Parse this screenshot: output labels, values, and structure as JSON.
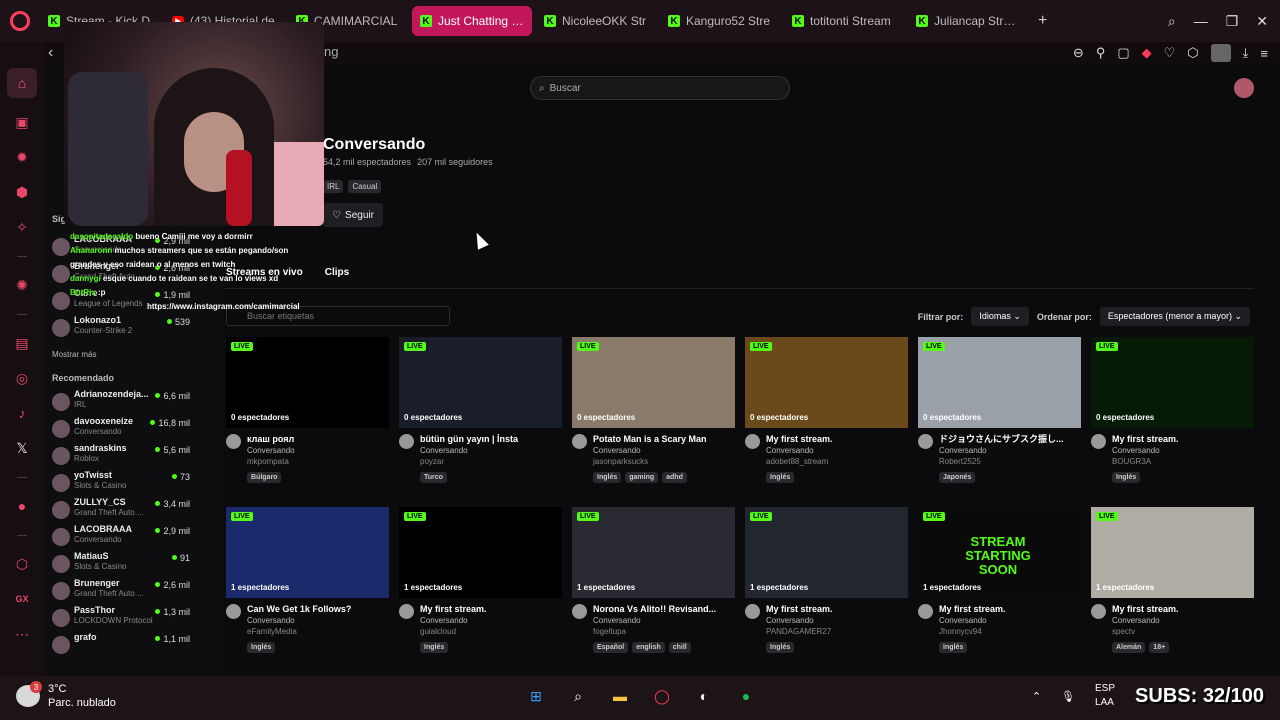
{
  "tabs": [
    {
      "label": "Stream - Kick D",
      "icon": "kick-icon",
      "active": false
    },
    {
      "label": "(43) Historial de",
      "icon": "youtube-icon",
      "active": false
    },
    {
      "label": "CAMIMARCIAL",
      "icon": "kick-icon",
      "active": false
    },
    {
      "label": "Just Chatting Streaming",
      "icon": "kick-icon",
      "active": true
    },
    {
      "label": "NicoleeOKK Str",
      "icon": "kick-icon",
      "active": false
    },
    {
      "label": "Kanguro52 Stre",
      "icon": "kick-icon",
      "active": false
    },
    {
      "label": "totitonti Stream",
      "icon": "kick-icon",
      "active": false
    },
    {
      "label": "Juliancap Stream",
      "icon": "kick-icon",
      "active": false
    }
  ],
  "url_fragment": "ng",
  "search": {
    "placeholder": "Buscar"
  },
  "category": {
    "title": "Conversando",
    "viewers": "54,2 mil espectadores",
    "followers": "207 mil seguidores",
    "tags": [
      "IRL",
      "Casual"
    ],
    "follow_label": "Seguir"
  },
  "subtabs": [
    "Streams en vivo",
    "Clips"
  ],
  "tag_search_placeholder": "Buscar etiquetas",
  "filters": {
    "filter_label": "Filtrar por:",
    "filter_value": "Idiomas",
    "order_label": "Ordenar por:",
    "order_value": "Espectadores (menor a mayor)"
  },
  "sidebar": {
    "following_header": "Sig",
    "following": [
      {
        "name": "LACOBRAAA",
        "category": "Conversando",
        "viewers": "2,9 mil"
      },
      {
        "name": "Brunenger",
        "category": "Grand Theft Auto ...",
        "viewers": "2,6 mil"
      },
      {
        "name": "Carre",
        "category": "League of Legends",
        "viewers": "1,9 mil"
      },
      {
        "name": "Lokonazo1",
        "category": "Counter-Strike 2",
        "viewers": "539"
      }
    ],
    "show_more": "Mostrar más",
    "recommended_header": "Recomendado",
    "recommended": [
      {
        "name": "Adrianozendeja...",
        "category": "IRL",
        "viewers": "6,6 mil"
      },
      {
        "name": "davooxeneize",
        "category": "Conversando",
        "viewers": "16,8 mil"
      },
      {
        "name": "sandraskins",
        "category": "Roblox",
        "viewers": "5,6 mil"
      },
      {
        "name": "yoTwisst",
        "category": "Slots & Casino",
        "viewers": "73"
      },
      {
        "name": "ZULLYY_CS",
        "category": "Grand Theft Auto ...",
        "viewers": "3,4 mil"
      },
      {
        "name": "LACOBRAAA",
        "category": "Conversando",
        "viewers": "2,9 mil"
      },
      {
        "name": "MatiauS",
        "category": "Slots & Casino",
        "viewers": "91"
      },
      {
        "name": "Brunenger",
        "category": "Grand Theft Auto ...",
        "viewers": "2,6 mil"
      },
      {
        "name": "PassThor",
        "category": "LOCKDOWN Protocol",
        "viewers": "1,3 mil"
      },
      {
        "name": "grafo",
        "category": "",
        "viewers": "1,1 mil"
      }
    ]
  },
  "streams_row1": [
    {
      "live": "LIVE",
      "viewers": "0 espectadores",
      "title": "клаш роял",
      "category": "Conversando",
      "owner": "mkpompata",
      "tags": [
        "Búlgaro"
      ],
      "thumb": "#000000"
    },
    {
      "live": "LIVE",
      "viewers": "0 espectadores",
      "title": "bütün gün yayın | İnsta",
      "category": "Conversando",
      "owner": "poyzar",
      "tags": [
        "Turco"
      ],
      "thumb": "#1a1d2a"
    },
    {
      "live": "LIVE",
      "viewers": "0 espectadores",
      "title": "Potato Man is a Scary Man",
      "category": "Conversando",
      "owner": "jasonparksucks",
      "tags": [
        "Inglés",
        "gaming",
        "adhd"
      ],
      "thumb": "#8a7a6a"
    },
    {
      "live": "LIVE",
      "viewers": "0 espectadores",
      "title": "My first stream.",
      "category": "Conversando",
      "owner": "adobet88_stream",
      "tags": [
        "Inglés"
      ],
      "thumb": "#6a4a1a"
    },
    {
      "live": "LIVE",
      "viewers": "0 espectadores",
      "title": "ドジョウさんにサブスク振し...",
      "category": "Conversando",
      "owner": "Robert2525",
      "tags": [
        "Japonés"
      ],
      "thumb": "#9aa0a8"
    },
    {
      "live": "LIVE",
      "viewers": "0 espectadores",
      "title": "My first stream.",
      "category": "Conversando",
      "owner": "BOUGR3A",
      "tags": [
        "Inglés"
      ],
      "thumb": "#061a06"
    }
  ],
  "streams_row2": [
    {
      "live": "LIVE",
      "viewers": "1 espectadores",
      "title": "Can We Get 1k Follows?",
      "category": "Conversando",
      "owner": "eFamilyMedia",
      "tags": [
        "Inglés"
      ],
      "thumb": "#1a2a6a"
    },
    {
      "live": "LIVE",
      "viewers": "1 espectadores",
      "title": "My first stream.",
      "category": "Conversando",
      "owner": "guialcloud",
      "tags": [
        "Inglés"
      ],
      "thumb": "#000000"
    },
    {
      "live": "LIVE",
      "viewers": "1 espectadores",
      "title": "Norona Vs Alito!! Revisand...",
      "category": "Conversando",
      "owner": "fogeltupa",
      "tags": [
        "Español",
        "english",
        "chill"
      ],
      "thumb": "#2a2a32"
    },
    {
      "live": "LIVE",
      "viewers": "1 espectadores",
      "title": "My first stream.",
      "category": "Conversando",
      "owner": "PANDAGAMER27",
      "tags": [
        "Inglés"
      ],
      "thumb": "#22262e"
    },
    {
      "live": "LIVE",
      "viewers": "1 espectadores",
      "title": "My first stream.",
      "category": "Conversando",
      "owner": "Jhonnycv94",
      "tags": [
        "Inglés"
      ],
      "thumb": "#0a0a0a",
      "overlay_text": "STREAM STARTING SOON"
    },
    {
      "live": "LIVE",
      "viewers": "1 espectadores",
      "title": "My first stream.",
      "category": "Conversando",
      "owner": "spectv",
      "tags": [
        "Alemán",
        "18+"
      ],
      "thumb": "#b0aca4"
    }
  ],
  "chat": [
    {
      "user": "dasopitadecaldo",
      "msg": "bueno Camiii me voy a dormirr"
    },
    {
      "user": "Ahanaronn",
      "msg": "muchos streamers que se están pegando/son"
    },
    {
      "user": "",
      "msg": "grandes y eso raidean o al menos en twitch"
    },
    {
      "user": "dannygi",
      "msg": "esque cuando te raidean se te van lo views xd"
    },
    {
      "user": "BotRix",
      "msg": ":p"
    }
  ],
  "chat_url": "https://www.instagram.com/camimarcial",
  "taskbar": {
    "temp": "3°C",
    "weather": "Parc. nublado",
    "badge": "3",
    "lang1": "ESP",
    "lang2": "LAA",
    "subs": "SUBS: 32/100"
  }
}
